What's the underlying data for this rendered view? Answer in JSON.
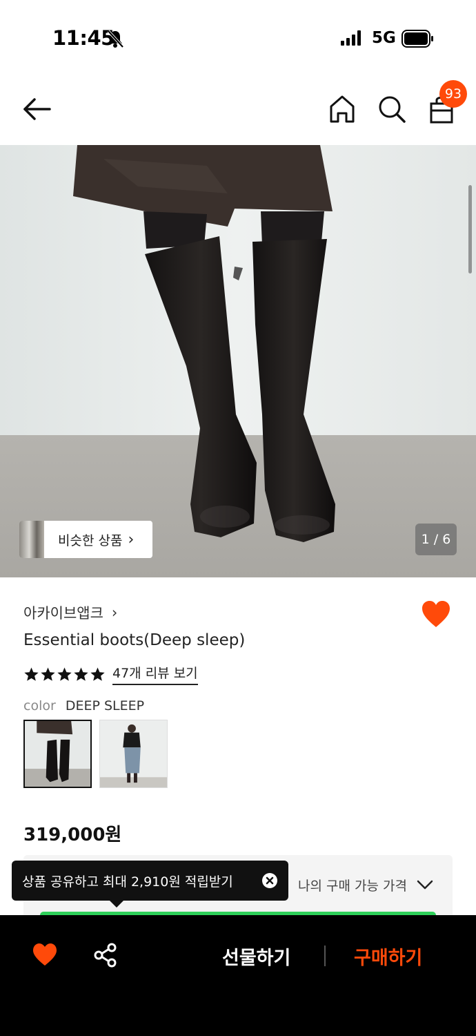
{
  "status_bar": {
    "time": "11:45",
    "network": "5G",
    "icons": [
      "bell-slash-icon",
      "signal-icon",
      "battery-icon"
    ]
  },
  "header": {
    "icons": [
      "back-arrow-icon",
      "home-icon",
      "search-icon",
      "shopping-bag-icon"
    ],
    "cart_count": "93"
  },
  "gallery": {
    "similar_label": "비슷한 상품",
    "similar_chevron": "›",
    "page_indicator": "1 / 6",
    "current_page": 1,
    "total_pages": 6
  },
  "product": {
    "brand": "아카이브앱크",
    "brand_chevron": "›",
    "title": "Essential boots(Deep sleep)",
    "rating_stars": 5,
    "review_link": "47개 리뷰 보기",
    "color_label": "color",
    "color_value": "DEEP SLEEP",
    "swatches": [
      "boots-closeup",
      "full-outfit"
    ],
    "price": "319,000원"
  },
  "purchase_panel": {
    "my_price_label": "나의 구매 가능 가격"
  },
  "tooltip": {
    "text": "상품 공유하고 최대 2,910원 적립받기"
  },
  "bottom_bar": {
    "gift_label": "선물하기",
    "buy_label": "구매하기"
  },
  "colors": {
    "accent": "#ff4a0a",
    "heart": "#ff4a0a",
    "badge": "#ff4a0a",
    "highlight_bar": "#2fd05a",
    "bottom_bar_bg": "#000000"
  }
}
